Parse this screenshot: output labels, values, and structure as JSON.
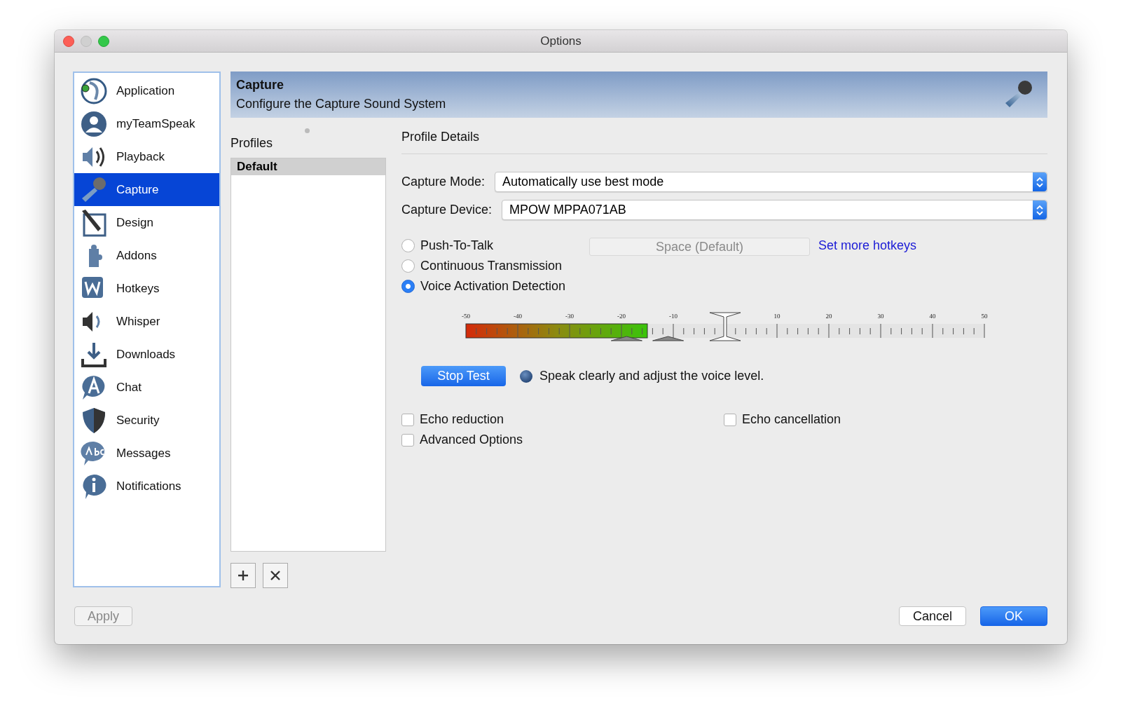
{
  "window": {
    "title": "Options"
  },
  "sidebar": {
    "items": [
      {
        "label": "Application",
        "selected": false
      },
      {
        "label": "myTeamSpeak",
        "selected": false
      },
      {
        "label": "Playback",
        "selected": false
      },
      {
        "label": "Capture",
        "selected": true
      },
      {
        "label": "Design",
        "selected": false
      },
      {
        "label": "Addons",
        "selected": false
      },
      {
        "label": "Hotkeys",
        "selected": false
      },
      {
        "label": "Whisper",
        "selected": false
      },
      {
        "label": "Downloads",
        "selected": false
      },
      {
        "label": "Chat",
        "selected": false
      },
      {
        "label": "Security",
        "selected": false
      },
      {
        "label": "Messages",
        "selected": false
      },
      {
        "label": "Notifications",
        "selected": false
      }
    ]
  },
  "header": {
    "title": "Capture",
    "subtitle": "Configure the Capture Sound System"
  },
  "profiles": {
    "label": "Profiles",
    "items": [
      {
        "label": "Default",
        "selected": true
      }
    ]
  },
  "details": {
    "title": "Profile Details",
    "capture_mode": {
      "label": "Capture Mode:",
      "value": "Automatically use best mode"
    },
    "capture_device": {
      "label": "Capture Device:",
      "value": "MPOW MPPA071AB"
    },
    "modes": [
      {
        "label": "Push-To-Talk",
        "selected": false
      },
      {
        "label": "Continuous Transmission",
        "selected": false
      },
      {
        "label": "Voice Activation Detection",
        "selected": true
      }
    ],
    "hotkey": {
      "value": "Space (Default)",
      "disabled": true
    },
    "hotkeys_link": "Set more hotkeys",
    "meter": {
      "ticks": [
        "-50",
        "-40",
        "-30",
        "-20",
        "-10",
        "10",
        "20",
        "30",
        "40",
        "50"
      ],
      "level": 0.35,
      "peaks": [
        {
          "level": 0.31
        },
        {
          "level": 0.39
        }
      ],
      "threshold": {
        "level": 0.5
      }
    },
    "test_button": "Stop Test",
    "test_hint": "Speak clearly and adjust the voice level.",
    "options": [
      {
        "label": "Echo reduction",
        "checked": false
      },
      {
        "label": "Echo cancellation",
        "checked": false
      },
      {
        "label": "Advanced Options",
        "checked": false
      }
    ]
  },
  "footer": {
    "apply": {
      "label": "Apply",
      "disabled": true
    },
    "cancel": "Cancel",
    "ok": "OK"
  }
}
